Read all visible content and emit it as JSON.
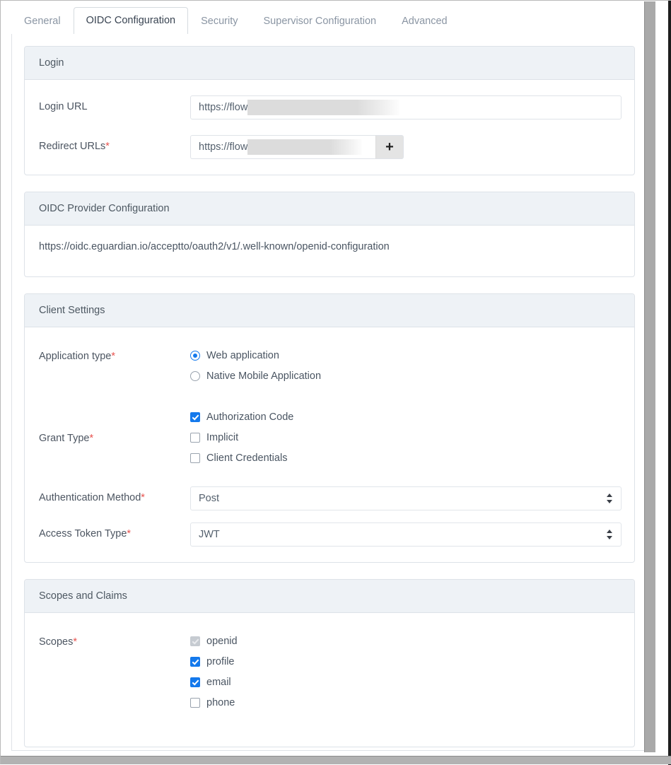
{
  "tabs": [
    {
      "label": "General",
      "active": false
    },
    {
      "label": "OIDC Configuration",
      "active": true
    },
    {
      "label": "Security",
      "active": false
    },
    {
      "label": "Supervisor Configuration",
      "active": false
    },
    {
      "label": "Advanced",
      "active": false
    }
  ],
  "colors": {
    "accent": "#1479ec",
    "required_asterisk": "#e8534f",
    "panel_header_bg": "#eef2f6",
    "panel_border": "#dde2e8",
    "text": "#4a5562",
    "tab_inactive": "#8a95a3",
    "tab_active": "#394452"
  },
  "login_panel": {
    "title": "Login",
    "login_url": {
      "label": "Login URL",
      "required": false,
      "value": "https://flow",
      "redacted": true
    },
    "redirect_urls": {
      "label": "Redirect URLs",
      "required": true,
      "required_marker": "*",
      "value": "https://flow",
      "redacted": true,
      "add_button_label": "+"
    }
  },
  "provider_panel": {
    "title": "OIDC Provider Configuration",
    "url": "https://oidc.eguardian.io/acceptto/oauth2/v1/.well-known/openid-configuration"
  },
  "client_settings_panel": {
    "title": "Client Settings",
    "application_type": {
      "label": "Application type",
      "required_marker": "*",
      "options": [
        {
          "label": "Web application",
          "checked": true
        },
        {
          "label": "Native Mobile Application",
          "checked": false
        }
      ]
    },
    "grant_type": {
      "label": "Grant Type",
      "required_marker": "*",
      "options": [
        {
          "label": "Authorization Code",
          "checked": true
        },
        {
          "label": "Implicit",
          "checked": false
        },
        {
          "label": "Client Credentials",
          "checked": false
        }
      ]
    },
    "authentication_method": {
      "label": "Authentication Method",
      "required_marker": "*",
      "value": "Post"
    },
    "access_token_type": {
      "label": "Access Token Type",
      "required_marker": "*",
      "value": "JWT"
    }
  },
  "scopes_panel": {
    "title": "Scopes and Claims",
    "scopes": {
      "label": "Scopes",
      "required_marker": "*",
      "options": [
        {
          "label": "openid",
          "checked": true,
          "disabled": true
        },
        {
          "label": "profile",
          "checked": true,
          "disabled": false
        },
        {
          "label": "email",
          "checked": true,
          "disabled": false
        },
        {
          "label": "phone",
          "checked": false,
          "disabled": false
        }
      ]
    }
  }
}
